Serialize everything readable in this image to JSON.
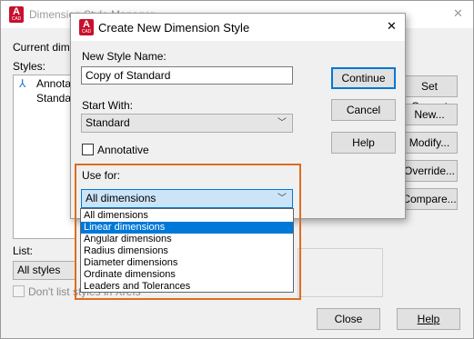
{
  "parent": {
    "title": "Dimension Style Manager",
    "current_label": "Current dimen",
    "styles_label": "Styles:",
    "style_items": [
      "Annotati",
      "Standar"
    ],
    "list_label": "List:",
    "list_value": "All styles",
    "dont_list": "Don't list styles in Xrefs",
    "buttons": {
      "set_current": "Set Current",
      "new": "New...",
      "modify": "Modify...",
      "override": "Override...",
      "compare": "Compare...",
      "close": "Close",
      "help": "Help"
    }
  },
  "dialog": {
    "logo": "A",
    "logo_sub": "CAD",
    "title": "Create New Dimension Style",
    "close_glyph": "✕",
    "new_style_label": "New Style Name:",
    "new_style_value": "Copy of Standard",
    "start_with_label": "Start With:",
    "start_with_value": "Standard",
    "annotative_label": "Annotative",
    "use_for_label": "Use for:",
    "use_for_value": "All dimensions",
    "dropdown_options": [
      "All dimensions",
      "Linear dimensions",
      "Angular dimensions",
      "Radius dimensions",
      "Diameter dimensions",
      "Ordinate dimensions",
      "Leaders and Tolerances"
    ],
    "selected_index": 1,
    "buttons": {
      "continue": "Continue",
      "cancel": "Cancel",
      "help": "Help"
    }
  },
  "colors": {
    "highlight": "#0078d7",
    "orange_outline": "#e06c1e",
    "logo_red": "#c8102e"
  }
}
